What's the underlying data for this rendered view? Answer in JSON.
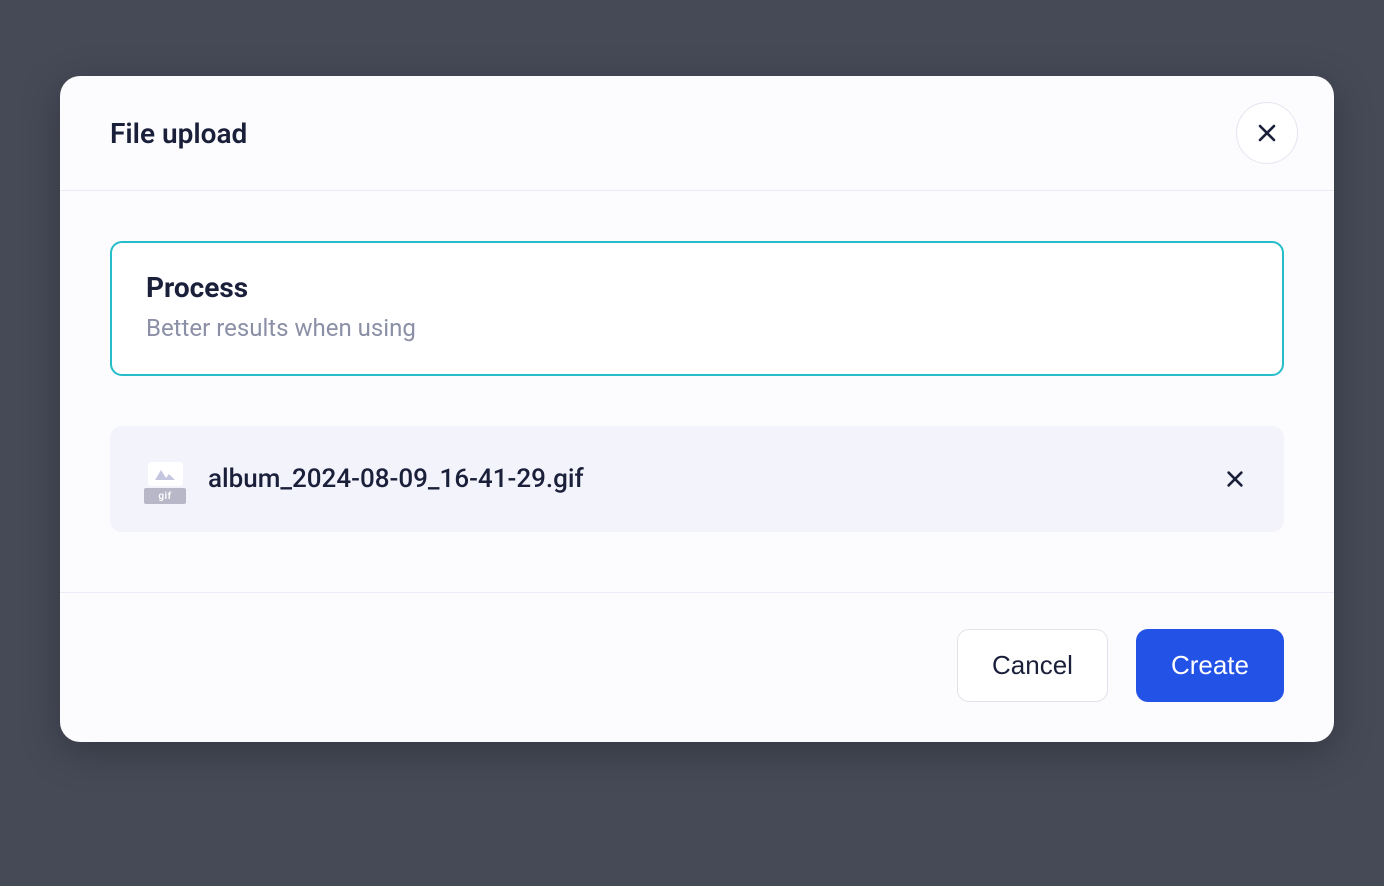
{
  "modal": {
    "title": "File upload",
    "process": {
      "title": "Process",
      "subtitle": "Better results when using"
    },
    "file": {
      "name": "album_2024-08-09_16-41-29.gif",
      "ext_label": "gif"
    },
    "footer": {
      "cancel_label": "Cancel",
      "create_label": "Create"
    }
  }
}
